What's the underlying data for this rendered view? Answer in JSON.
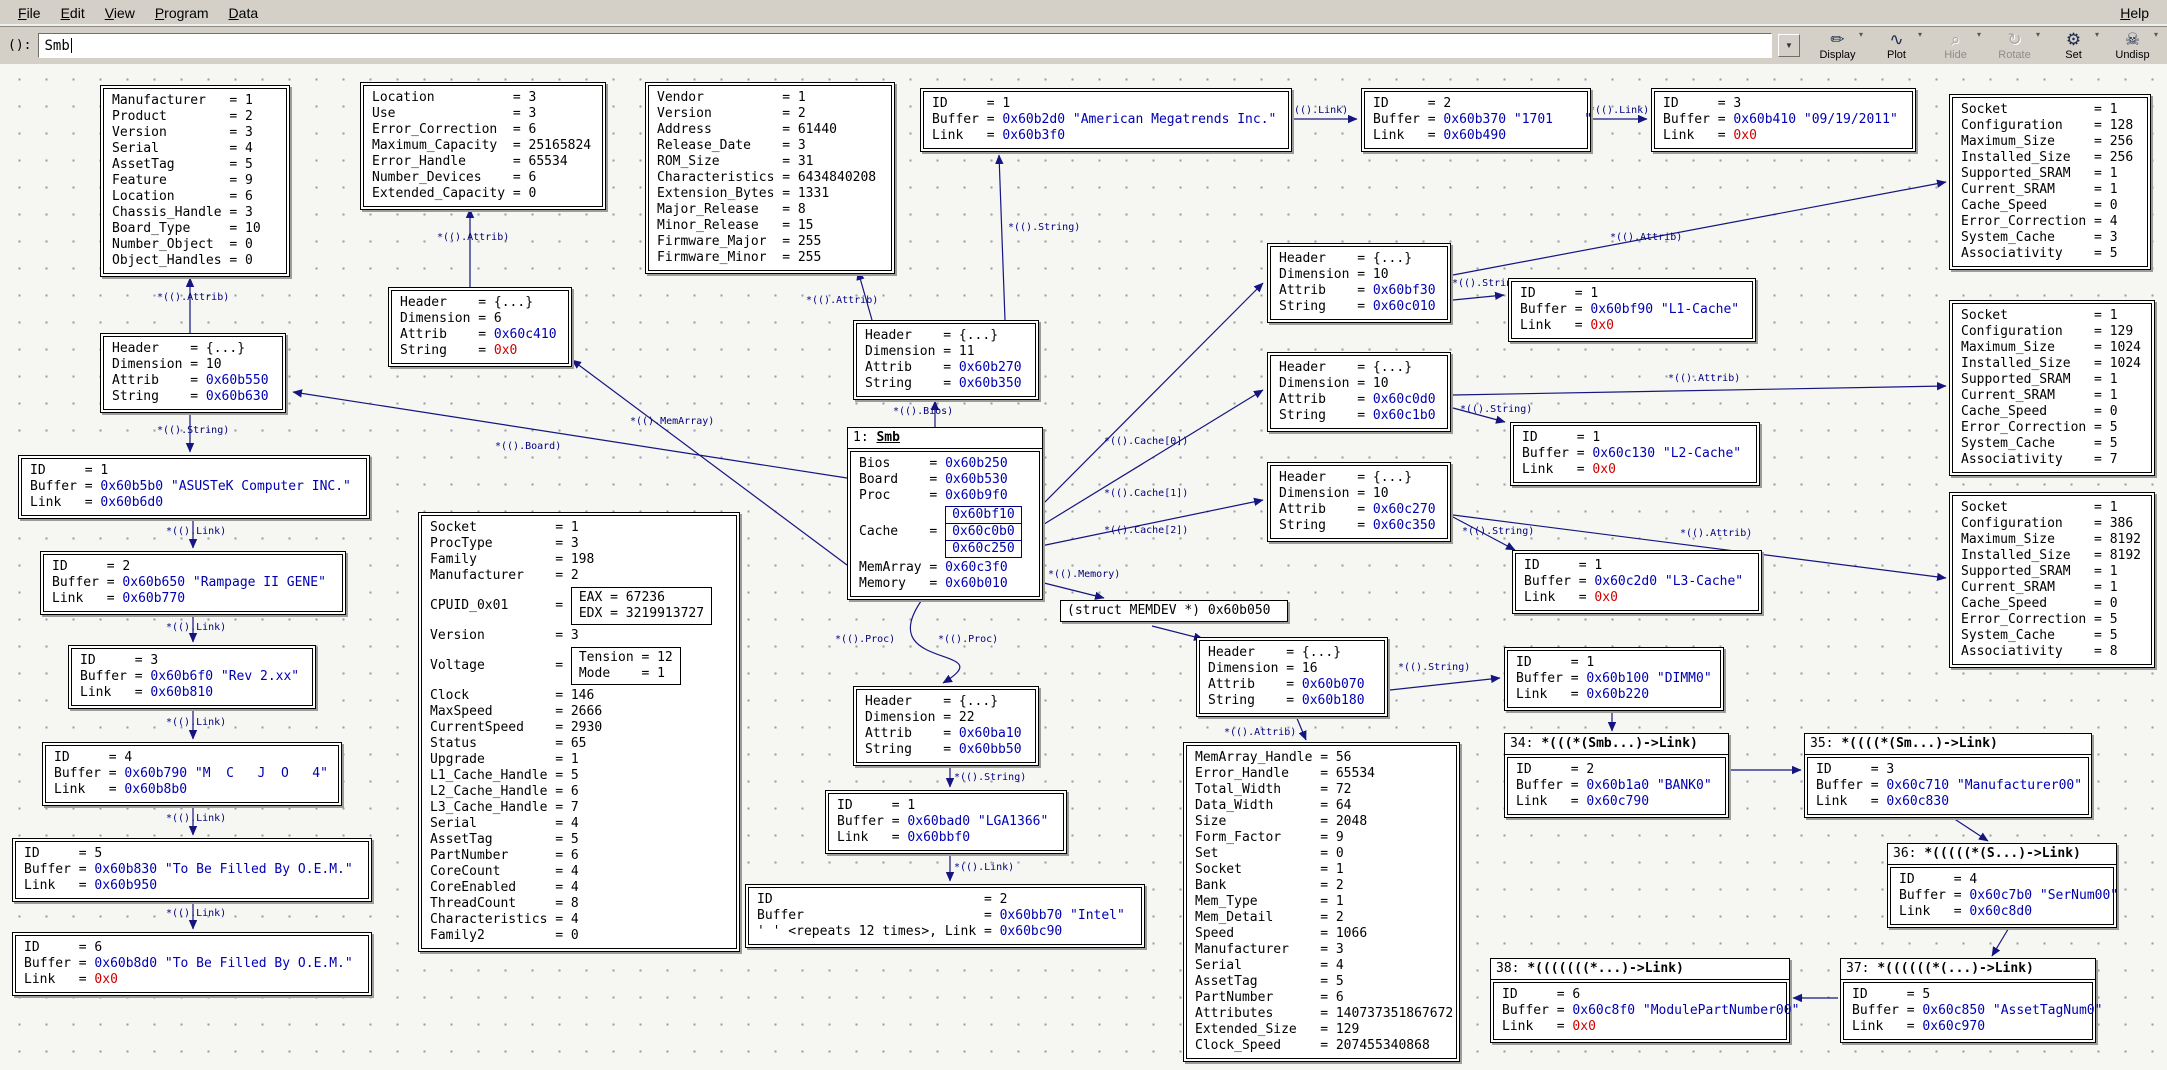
{
  "menu": {
    "items": [
      "File",
      "Edit",
      "View",
      "Program",
      "Data"
    ],
    "help": "Help"
  },
  "command": {
    "prompt": "():",
    "value": "Smb"
  },
  "toolbar": {
    "buttons": [
      {
        "label": "Display",
        "icon": "display-icon",
        "enabled": true
      },
      {
        "label": "Plot",
        "icon": "plot-icon",
        "enabled": true
      },
      {
        "label": "Hide",
        "icon": "hide-icon",
        "enabled": false
      },
      {
        "label": "Rotate",
        "icon": "rotate-icon",
        "enabled": false
      },
      {
        "label": "Set",
        "icon": "set-icon",
        "enabled": true
      },
      {
        "label": "Undisp",
        "icon": "undisp-icon",
        "enabled": true
      }
    ]
  },
  "colors": {
    "edge": "#151580",
    "pointer": "#0000b2",
    "null_pointer": "#cf0000"
  },
  "edge_labels": {
    "attrib": "*(().Attrib)",
    "string": "*(().String)",
    "link": "*(().Link)",
    "bios": "*(().Bios)",
    "board": "*(().Board)",
    "proc": "*(().Proc)",
    "cache0": "*(().Cache[0])",
    "cache1": "*(().Cache[1])",
    "cache2": "*(().Cache[2])",
    "memarray": "*(().MemArray)",
    "memory": "*(().Memory)"
  },
  "boxes": {
    "manuf": {
      "rows": [
        [
          "Manufacturer",
          "1"
        ],
        [
          "Product",
          "2"
        ],
        [
          "Version",
          "3"
        ],
        [
          "Serial",
          "4"
        ],
        [
          "AssetTag",
          "5"
        ],
        [
          "Feature",
          "9"
        ],
        [
          "Location",
          "6"
        ],
        [
          "Chassis_Handle",
          "3"
        ],
        [
          "Board_Type",
          "10"
        ],
        [
          "Number_Object",
          "0"
        ],
        [
          "Object_Handles",
          "0"
        ]
      ]
    },
    "mem_attr": {
      "rows": [
        [
          "Location",
          "3"
        ],
        [
          "Use",
          "3"
        ],
        [
          "Error_Correction",
          "6"
        ],
        [
          "Maximum_Capacity",
          "25165824"
        ],
        [
          "Error_Handle",
          "65534"
        ],
        [
          "Number_Devices",
          "6"
        ],
        [
          "Extended_Capacity",
          "0"
        ]
      ]
    },
    "hdr_memarr": {
      "rows": [
        [
          "Header",
          "{...}"
        ],
        [
          "Dimension",
          "6"
        ],
        [
          "Attrib",
          "0x60c410"
        ],
        [
          "String",
          "0x0"
        ]
      ]
    },
    "bios_attr": {
      "rows": [
        [
          "Vendor",
          "1"
        ],
        [
          "Version",
          "2"
        ],
        [
          "Address",
          "61440"
        ],
        [
          "Release_Date",
          "3"
        ],
        [
          "ROM_Size",
          "31"
        ],
        [
          "Characteristics",
          "6434840208"
        ],
        [
          "Extension_Bytes",
          "1331"
        ],
        [
          "Major_Release",
          "8"
        ],
        [
          "Minor_Release",
          "15"
        ],
        [
          "Firmware_Major",
          "255"
        ],
        [
          "Firmware_Minor",
          "255"
        ]
      ]
    },
    "id_am": {
      "rows": [
        [
          "ID",
          "1"
        ],
        [
          "Buffer",
          "0x60b2d0 \"American Megatrends Inc.\""
        ],
        [
          "Link",
          "0x60b3f0"
        ]
      ]
    },
    "id_1701": {
      "rows": [
        [
          "ID",
          "2"
        ],
        [
          "Buffer",
          "0x60b370 \"1701    \""
        ],
        [
          "Link",
          "0x60b490"
        ]
      ]
    },
    "id_date": {
      "rows": [
        [
          "ID",
          "3"
        ],
        [
          "Buffer",
          "0x60b410 \"09/19/2011\""
        ],
        [
          "Link",
          "0x0"
        ]
      ]
    },
    "l1_attr": {
      "rows": [
        [
          "Socket",
          "1"
        ],
        [
          "Configuration",
          "128"
        ],
        [
          "Maximum_Size",
          "256"
        ],
        [
          "Installed_Size",
          "256"
        ],
        [
          "Supported_SRAM",
          "1"
        ],
        [
          "Current_SRAM",
          "1"
        ],
        [
          "Cache_Speed",
          "0"
        ],
        [
          "Error_Correction",
          "4"
        ],
        [
          "System_Cache",
          "3"
        ],
        [
          "Associativity",
          "5"
        ]
      ]
    },
    "l2_attr": {
      "rows": [
        [
          "Socket",
          "1"
        ],
        [
          "Configuration",
          "129"
        ],
        [
          "Maximum_Size",
          "1024"
        ],
        [
          "Installed_Size",
          "1024"
        ],
        [
          "Supported_SRAM",
          "1"
        ],
        [
          "Current_SRAM",
          "1"
        ],
        [
          "Cache_Speed",
          "0"
        ],
        [
          "Error_Correction",
          "5"
        ],
        [
          "System_Cache",
          "5"
        ],
        [
          "Associativity",
          "7"
        ]
      ]
    },
    "l3_attr": {
      "rows": [
        [
          "Socket",
          "1"
        ],
        [
          "Configuration",
          "386"
        ],
        [
          "Maximum_Size",
          "8192"
        ],
        [
          "Installed_Size",
          "8192"
        ],
        [
          "Supported_SRAM",
          "1"
        ],
        [
          "Current_SRAM",
          "1"
        ],
        [
          "Cache_Speed",
          "0"
        ],
        [
          "Error_Correction",
          "5"
        ],
        [
          "System_Cache",
          "5"
        ],
        [
          "Associativity",
          "8"
        ]
      ]
    },
    "hdr_c0": {
      "rows": [
        [
          "Header",
          "{...}"
        ],
        [
          "Dimension",
          "10"
        ],
        [
          "Attrib",
          "0x60bf30"
        ],
        [
          "String",
          "0x60c010"
        ]
      ]
    },
    "id_l1c": {
      "rows": [
        [
          "ID",
          "1"
        ],
        [
          "Buffer",
          "0x60bf90 \"L1-Cache\""
        ],
        [
          "Link",
          "0x0"
        ]
      ]
    },
    "hdr_c1": {
      "rows": [
        [
          "Header",
          "{...}"
        ],
        [
          "Dimension",
          "10"
        ],
        [
          "Attrib",
          "0x60c0d0"
        ],
        [
          "String",
          "0x60c1b0"
        ]
      ]
    },
    "id_l2c": {
      "rows": [
        [
          "ID",
          "1"
        ],
        [
          "Buffer",
          "0x60c130 \"L2-Cache\""
        ],
        [
          "Link",
          "0x0"
        ]
      ]
    },
    "hdr_c2": {
      "rows": [
        [
          "Header",
          "{...}"
        ],
        [
          "Dimension",
          "10"
        ],
        [
          "Attrib",
          "0x60c270"
        ],
        [
          "String",
          "0x60c350"
        ]
      ]
    },
    "id_l3c": {
      "rows": [
        [
          "ID",
          "1"
        ],
        [
          "Buffer",
          "0x60c2d0 \"L3-Cache\""
        ],
        [
          "Link",
          "0x0"
        ]
      ]
    },
    "hdr_bios": {
      "rows": [
        [
          "Header",
          "{...}"
        ],
        [
          "Dimension",
          "11"
        ],
        [
          "Attrib",
          "0x60b270"
        ],
        [
          "String",
          "0x60b350"
        ]
      ]
    },
    "smb": {
      "title": {
        "num": "1:",
        "name": "Smb"
      },
      "rows": [
        [
          "Bios",
          "0x60b250"
        ],
        [
          "Board",
          "0x60b530"
        ],
        [
          "Proc",
          "0x60b9f0"
        ],
        [
          "Cache",
          {
            "stack": [
              "0x60bf10",
              "0x60c0b0",
              "0x60c250"
            ]
          }
        ],
        [
          "MemArray",
          "0x60c3f0"
        ],
        [
          "Memory",
          "0x60b010"
        ]
      ]
    },
    "hdr_board": {
      "rows": [
        [
          "Header",
          "{...}"
        ],
        [
          "Dimension",
          "10"
        ],
        [
          "Attrib",
          "0x60b550"
        ],
        [
          "String",
          "0x60b630"
        ]
      ]
    },
    "id_asus": {
      "rows": [
        [
          "ID",
          "1"
        ],
        [
          "Buffer",
          "0x60b5b0 \"ASUSTeK Computer INC.\""
        ],
        [
          "Link",
          "0x60b6d0"
        ]
      ]
    },
    "id_ramp": {
      "rows": [
        [
          "ID",
          "2"
        ],
        [
          "Buffer",
          "0x60b650 \"Rampage II GENE\""
        ],
        [
          "Link",
          "0x60b770"
        ]
      ]
    },
    "id_rev": {
      "rows": [
        [
          "ID",
          "3"
        ],
        [
          "Buffer",
          "0x60b6f0 \"Rev 2.xx\""
        ],
        [
          "Link",
          "0x60b810"
        ]
      ]
    },
    "id_mcjo": {
      "rows": [
        [
          "ID",
          "4"
        ],
        [
          "Buffer",
          "0x60b790 \"M  C   J  O   4\""
        ],
        [
          "Link",
          "0x60b8b0"
        ]
      ]
    },
    "id_oem1": {
      "rows": [
        [
          "ID",
          "5"
        ],
        [
          "Buffer",
          "0x60b830 \"To Be Filled By O.E.M.\""
        ],
        [
          "Link",
          "0x60b950"
        ]
      ]
    },
    "id_oem2": {
      "rows": [
        [
          "ID",
          "6"
        ],
        [
          "Buffer",
          "0x60b8d0 \"To Be Filled By O.E.M.\""
        ],
        [
          "Link",
          "0x0"
        ]
      ]
    },
    "proc": {
      "rows": [
        [
          "Socket",
          "1"
        ],
        [
          "ProcType",
          "3"
        ],
        [
          "Family",
          "198"
        ],
        [
          "Manufacturer",
          "2"
        ],
        [
          "CPUID_0x01",
          {
            "box": [
              [
                "EAX",
                "67236"
              ],
              [
                "EDX",
                "3219913727"
              ]
            ],
            "nc": 3
          }
        ],
        [
          "Version",
          "3"
        ],
        [
          "Voltage",
          {
            "box": [
              [
                "Tension",
                "12"
              ],
              [
                "Mode",
                "1"
              ]
            ],
            "nc": 7
          }
        ],
        [
          "Clock",
          "146"
        ],
        [
          "MaxSpeed",
          "2666"
        ],
        [
          "CurrentSpeed",
          "2930"
        ],
        [
          "Status",
          "65"
        ],
        [
          "Upgrade",
          "1"
        ],
        [
          "L1_Cache_Handle",
          "5"
        ],
        [
          "L2_Cache_Handle",
          "6"
        ],
        [
          "L3_Cache_Handle",
          "7"
        ],
        [
          "Serial",
          "4"
        ],
        [
          "AssetTag",
          "5"
        ],
        [
          "PartNumber",
          "6"
        ],
        [
          "CoreCount",
          "4"
        ],
        [
          "CoreEnabled",
          "4"
        ],
        [
          "ThreadCount",
          "8"
        ],
        [
          "Characteristics",
          "4"
        ],
        [
          "Family2",
          "0"
        ]
      ]
    },
    "hdr_proc": {
      "rows": [
        [
          "Header",
          "{...}"
        ],
        [
          "Dimension",
          "22"
        ],
        [
          "Attrib",
          "0x60ba10"
        ],
        [
          "String",
          "0x60bb50"
        ]
      ]
    },
    "id_lga": {
      "rows": [
        [
          "ID",
          "1"
        ],
        [
          "Buffer",
          "0x60bad0 \"LGA1366\""
        ],
        [
          "Link",
          "0x60bbf0"
        ]
      ]
    },
    "id_intel": {
      "rows": [
        [
          "ID",
          "2"
        ],
        [
          "Buffer",
          "0x60bb70 \"Intel\""
        ],
        [
          "' ' <repeats 12 times>, Link",
          "0x60bc90"
        ]
      ]
    },
    "memdev_cast": {
      "title_text": "(struct MEMDEV *) 0x60b050"
    },
    "hdr_mem": {
      "rows": [
        [
          "Header",
          "{...}"
        ],
        [
          "Dimension",
          "16"
        ],
        [
          "Attrib",
          "0x60b070"
        ],
        [
          "String",
          "0x60b180"
        ]
      ]
    },
    "id_dimm": {
      "rows": [
        [
          "ID",
          "1"
        ],
        [
          "Buffer",
          "0x60b100 \"DIMM0\""
        ],
        [
          "Link",
          "0x60b220"
        ]
      ]
    },
    "memdev": {
      "rows": [
        [
          "MemArray_Handle",
          "56"
        ],
        [
          "Error_Handle",
          "65534"
        ],
        [
          "Total_Width",
          "72"
        ],
        [
          "Data_Width",
          "64"
        ],
        [
          "Size",
          "2048"
        ],
        [
          "Form_Factor",
          "9"
        ],
        [
          "Set",
          "0"
        ],
        [
          "Socket",
          "1"
        ],
        [
          "Bank",
          "2"
        ],
        [
          "Mem_Type",
          "1"
        ],
        [
          "Mem_Detail",
          "2"
        ],
        [
          "Speed",
          "1066"
        ],
        [
          "Manufacturer",
          "3"
        ],
        [
          "Serial",
          "4"
        ],
        [
          "AssetTag",
          "5"
        ],
        [
          "PartNumber",
          "6"
        ],
        [
          "Attributes",
          "140737351867672"
        ],
        [
          "Extended_Size",
          "129"
        ],
        [
          "Clock_Speed",
          "207455340868"
        ]
      ]
    },
    "l34": {
      "title": {
        "num": "34:",
        "name": "*(((*(Smb...)->Link)"
      },
      "rows": [
        [
          "ID",
          "2"
        ],
        [
          "Buffer",
          "0x60b1a0 \"BANK0\""
        ],
        [
          "Link",
          "0x60c790"
        ]
      ]
    },
    "l35": {
      "title": {
        "num": "35:",
        "name": "*((((*(Sm...)->Link)"
      },
      "rows": [
        [
          "ID",
          "3"
        ],
        [
          "Buffer",
          "0x60c710 \"Manufacturer00\""
        ],
        [
          "Link",
          "0x60c830"
        ]
      ]
    },
    "l36": {
      "title": {
        "num": "36:",
        "name": "*(((((*(S...)->Link)"
      },
      "rows": [
        [
          "ID",
          "4"
        ],
        [
          "Buffer",
          "0x60c7b0 \"SerNum00\""
        ],
        [
          "Link",
          "0x60c8d0"
        ]
      ]
    },
    "l37": {
      "title": {
        "num": "37:",
        "name": "*((((((*(...)->Link)"
      },
      "rows": [
        [
          "ID",
          "5"
        ],
        [
          "Buffer",
          "0x60c850 \"AssetTagNum0\""
        ],
        [
          "Link",
          "0x60c970"
        ]
      ]
    },
    "l38": {
      "title": {
        "num": "38:",
        "name": "*(((((((*...)->Link)"
      },
      "rows": [
        [
          "ID",
          "6"
        ],
        [
          "Buffer",
          "0x60c8f0 \"ModulePartNumber00\""
        ],
        [
          "Link",
          "0x0"
        ]
      ]
    }
  }
}
